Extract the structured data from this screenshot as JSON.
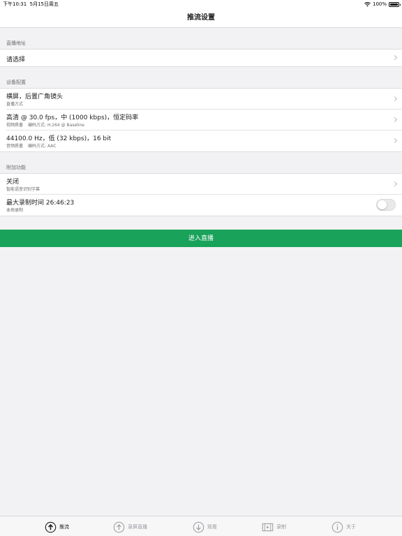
{
  "status_bar": {
    "time": "下午10:31",
    "date": "5月15日周五",
    "battery": "100%"
  },
  "nav": {
    "title": "推流设置"
  },
  "sections": {
    "address": {
      "header": "直播地址",
      "row_title": "请选择"
    },
    "device": {
      "header": "设备配置",
      "rows": [
        {
          "title": "横屏，后置广角镜头",
          "subtitle": "直播方式"
        },
        {
          "title": "高清 @ 30.0 fps，中 (1000 kbps)，恒定码率",
          "subtitle": "视频质量",
          "subtitle2": "编码方式: H.264 @ Baseline"
        },
        {
          "title": "44100.0 Hz，低 (32 kbps)，16 bit",
          "subtitle": "音频质量",
          "subtitle2": "编码方式: AAC"
        }
      ]
    },
    "extra": {
      "header": "附加功能",
      "rows": [
        {
          "title": "关闭",
          "subtitle": "智能语音识别字幕"
        },
        {
          "title": "最大录制时间  26:46:23",
          "subtitle": "本地录制"
        }
      ]
    }
  },
  "local_record_enabled": false,
  "live_button": {
    "label": "进入直播"
  },
  "tabs": [
    {
      "label": "推流",
      "icon": "push-stream-icon",
      "active": true
    },
    {
      "label": "录屏直播",
      "icon": "screen-record-icon",
      "active": false
    },
    {
      "label": "观看",
      "icon": "watch-icon",
      "active": false
    },
    {
      "label": "录制",
      "icon": "film-record-icon",
      "active": false
    },
    {
      "label": "关于",
      "icon": "info-icon",
      "active": false
    }
  ],
  "colors": {
    "accent_green": "#18a25a",
    "background": "#f2f2f4"
  }
}
